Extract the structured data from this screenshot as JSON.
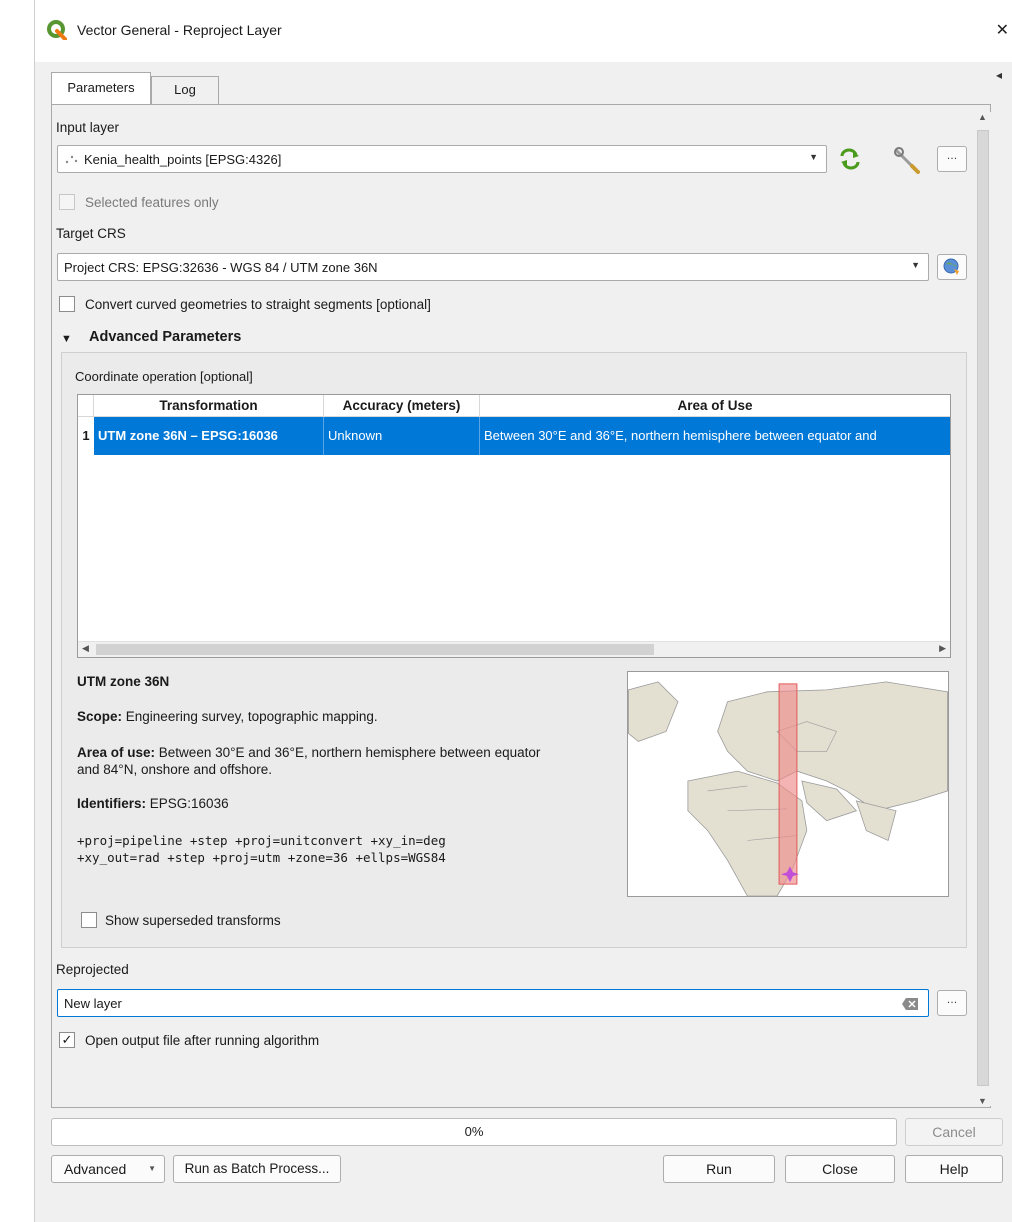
{
  "window": {
    "title": "Vector General - Reproject Layer",
    "close_glyph": "✕",
    "app_icon": "qgis-logo-icon",
    "collapse_glyph": "◂"
  },
  "tabs": [
    {
      "label": "Parameters",
      "active": true
    },
    {
      "label": "Log",
      "active": false
    }
  ],
  "input_layer": {
    "label": "Input layer",
    "value": "Kenia_health_points [EPSG:4326]",
    "layer_icon": "point-layer-icon",
    "iterate_icon": "iterate-icon",
    "settings_icon": "wrench-icon",
    "browse_label": "…",
    "selected_only_label": "Selected features only",
    "selected_only_checked": false
  },
  "target_crs": {
    "label": "Target CRS",
    "value": "Project CRS: EPSG:32636 - WGS 84 / UTM zone 36N",
    "crs_icon": "globe-crs-icon"
  },
  "convert_curved": {
    "label": "Convert curved geometries to straight segments [optional]",
    "checked": false
  },
  "advanced": {
    "toggle_glyph": "▼",
    "label": "Advanced Parameters",
    "coord_op_label": "Coordinate operation [optional]",
    "table": {
      "headers": [
        "Transformation",
        "Accuracy (meters)",
        "Area of Use"
      ],
      "rows": [
        {
          "num": "1",
          "transformation": "UTM zone 36N – EPSG:16036",
          "accuracy": "Unknown",
          "area": "Between 30°E and 36°E, northern hemisphere between equator and"
        }
      ]
    },
    "details": {
      "name": "UTM zone 36N",
      "scope_label": "Scope:",
      "scope": "Engineering survey, topographic mapping.",
      "area_label": "Area of use:",
      "area_line1": "Between 30°E and 36°E, northern hemisphere between equator",
      "area_line2": "and 84°N, onshore and offshore.",
      "identifiers_label": "Identifiers:",
      "identifiers": "EPSG:16036",
      "proj_line1": "+proj=pipeline +step +proj=unitconvert +xy_in=deg",
      "proj_line2": "+xy_out=rad +step +proj=utm +zone=36 +ellps=WGS84"
    },
    "show_superseded_label": "Show superseded transforms",
    "show_superseded_checked": false
  },
  "output": {
    "label": "Reprojected",
    "value": "New layer",
    "clear_icon": "clear-field-icon",
    "browse_label": "…",
    "open_after_label": "Open output file after running algorithm",
    "open_after_checked": true
  },
  "footer": {
    "progress_text": "0%",
    "progress_fraction": 0,
    "cancel_label": "Cancel",
    "advanced_label": "Advanced",
    "batch_label": "Run as Batch Process...",
    "run_label": "Run",
    "close_label": "Close",
    "help_label": "Help"
  }
}
